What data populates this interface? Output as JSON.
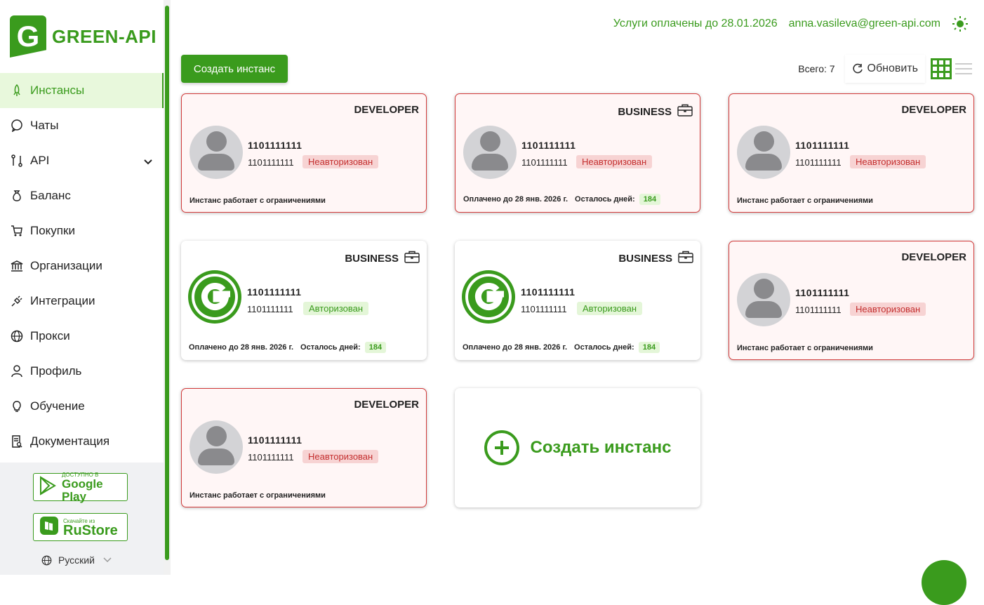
{
  "brand": {
    "logo_letter": "G",
    "name": "GREEN-API",
    "accent": "#3a9b1d"
  },
  "sidebar": {
    "items": [
      {
        "label": "Инстансы",
        "icon": "rocket-icon",
        "active": true
      },
      {
        "label": "Чаты",
        "icon": "chat-icon"
      },
      {
        "label": "API",
        "icon": "api-icon",
        "expandable": true
      },
      {
        "label": "Баланс",
        "icon": "money-bag-icon"
      },
      {
        "label": "Покупки",
        "icon": "cart-icon"
      },
      {
        "label": "Организации",
        "icon": "bank-icon"
      },
      {
        "label": "Интеграции",
        "icon": "plug-icon"
      },
      {
        "label": "Прокси",
        "icon": "globe-icon"
      },
      {
        "label": "Профиль",
        "icon": "user-icon"
      },
      {
        "label": "Обучение",
        "icon": "bulb-icon"
      },
      {
        "label": "Документация",
        "icon": "document-icon"
      }
    ],
    "google_play": {
      "small": "ДОСТУПНО В",
      "big": "Google Play"
    },
    "rustore": {
      "small": "Скачайте из",
      "big": "RuStore"
    },
    "language": "Русский"
  },
  "header": {
    "paid_until": "Услуги оплачены до 28.01.2026",
    "email": "anna.vasileva@green-api.com"
  },
  "toolbar": {
    "create_label": "Создать инстанс",
    "total": "Всего: 7",
    "refresh_label": "Обновить"
  },
  "cards": [
    {
      "plan": "DEVELOPER",
      "id": "1101111111",
      "sub": "1101111111",
      "status": "Неавторизован",
      "footer": "Инстанс работает с ограничениями"
    },
    {
      "plan": "BUSINESS",
      "id": "1101111111",
      "sub": "1101111111",
      "status": "Неавторизован",
      "footer_paid": "Оплачено до 28 янв. 2026 г.",
      "footer_days_label": "Осталось дней:",
      "days": "184"
    },
    {
      "plan": "DEVELOPER",
      "id": "1101111111",
      "sub": "1101111111",
      "status": "Неавторизован",
      "footer": "Инстанс работает с ограничениями"
    },
    {
      "plan": "BUSINESS",
      "id": "1101111111",
      "sub": "1101111111",
      "status": "Авторизован",
      "footer_paid": "Оплачено до 28 янв. 2026 г.",
      "footer_days_label": "Осталось дней:",
      "days": "184"
    },
    {
      "plan": "BUSINESS",
      "id": "1101111111",
      "sub": "1101111111",
      "status": "Авторизован",
      "footer_paid": "Оплачено до 28 янв. 2026 г.",
      "footer_days_label": "Осталось дней:",
      "days": "184"
    },
    {
      "plan": "DEVELOPER",
      "id": "1101111111",
      "sub": "1101111111",
      "status": "Неавторизован",
      "footer": "Инстанс работает с ограничениями"
    },
    {
      "plan": "DEVELOPER",
      "id": "1101111111",
      "sub": "1101111111",
      "status": "Неавторизован",
      "footer": "Инстанс работает с ограничениями"
    }
  ],
  "create_card": {
    "label": "Создать инстанс"
  }
}
